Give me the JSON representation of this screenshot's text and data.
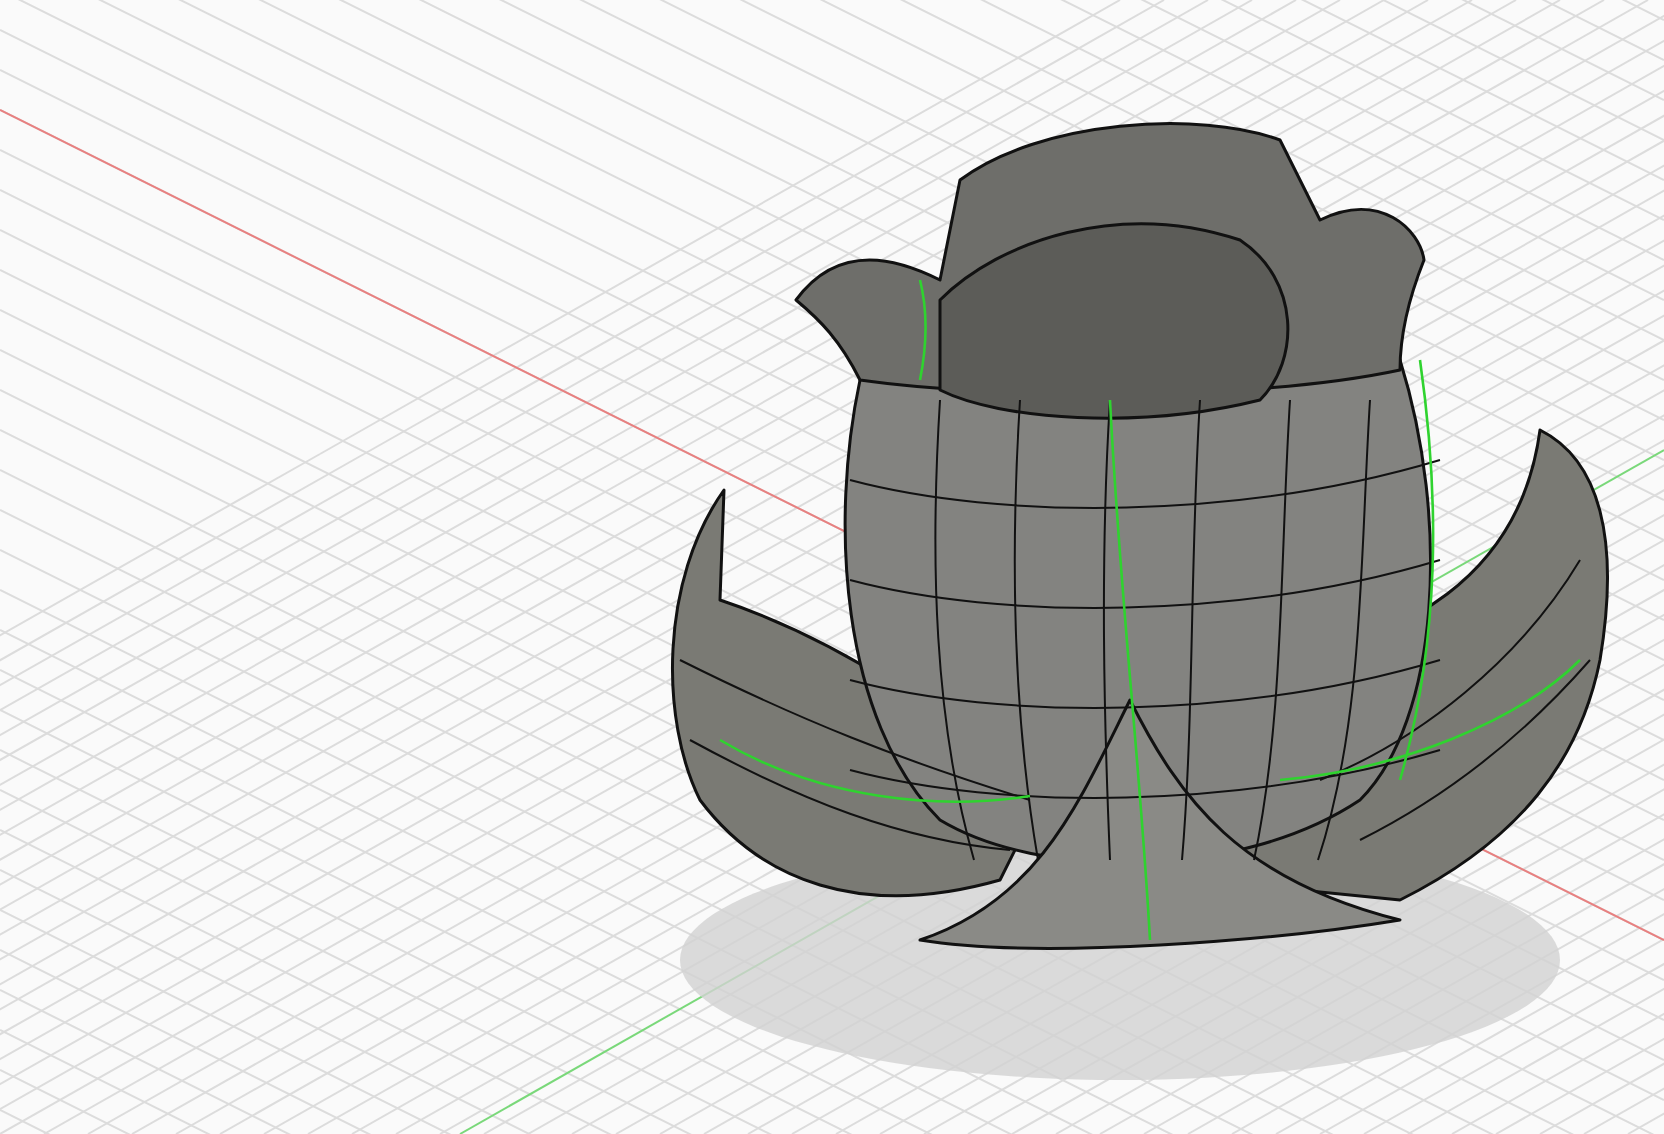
{
  "viewport": {
    "axes": [
      {
        "color": "#e88080"
      },
      {
        "color": "#7ad87a"
      }
    ]
  }
}
